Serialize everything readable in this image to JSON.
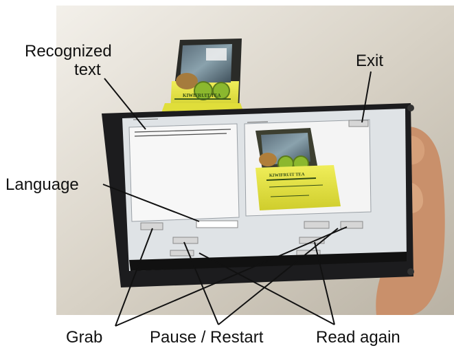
{
  "annotations": {
    "recognized_text_line1": "Recognized",
    "recognized_text_line2": "text",
    "exit": "Exit",
    "language": "Language",
    "grab": "Grab",
    "pause_restart": "Pause / Restart",
    "read_again": "Read again"
  },
  "product": {
    "box_label": "KIWIFRUIT TEA"
  },
  "colors": {
    "tablet_frame": "#1c1c1e",
    "screen_bg": "#dfe3e6",
    "tea_box_yellow": "#e3e23c",
    "kiwi_green": "#8bb82e",
    "background_wall": "#cfc9bd"
  }
}
